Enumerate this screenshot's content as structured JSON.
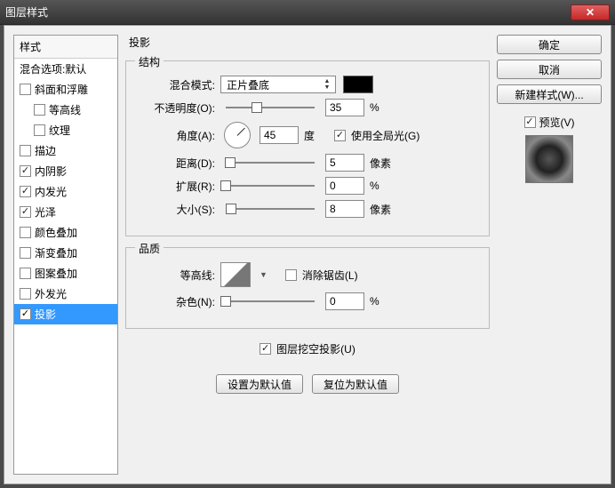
{
  "window": {
    "title": "图层样式"
  },
  "styles": {
    "header": "样式",
    "blend_defaults": "混合选项:默认",
    "items": [
      {
        "label": "斜面和浮雕",
        "checked": false,
        "indent": false
      },
      {
        "label": "等高线",
        "checked": false,
        "indent": true
      },
      {
        "label": "纹理",
        "checked": false,
        "indent": true
      },
      {
        "label": "描边",
        "checked": false,
        "indent": false
      },
      {
        "label": "内阴影",
        "checked": true,
        "indent": false
      },
      {
        "label": "内发光",
        "checked": true,
        "indent": false
      },
      {
        "label": "光泽",
        "checked": true,
        "indent": false
      },
      {
        "label": "颜色叠加",
        "checked": false,
        "indent": false
      },
      {
        "label": "渐变叠加",
        "checked": false,
        "indent": false
      },
      {
        "label": "图案叠加",
        "checked": false,
        "indent": false
      },
      {
        "label": "外发光",
        "checked": false,
        "indent": false
      },
      {
        "label": "投影",
        "checked": true,
        "indent": false,
        "selected": true
      }
    ]
  },
  "center": {
    "title": "投影",
    "structure": {
      "title": "结构",
      "blend_mode_label": "混合模式:",
      "blend_mode_value": "正片叠底",
      "color": "#000000",
      "opacity_label": "不透明度(O):",
      "opacity_value": "35",
      "opacity_unit": "%",
      "opacity_pos": "35%",
      "angle_label": "角度(A):",
      "angle_value": "45",
      "angle_unit": "度",
      "global_light_label": "使用全局光(G)",
      "global_light_checked": true,
      "distance_label": "距离(D):",
      "distance_value": "5",
      "distance_unit": "像素",
      "distance_pos": "5%",
      "spread_label": "扩展(R):",
      "spread_value": "0",
      "spread_unit": "%",
      "spread_pos": "0%",
      "size_label": "大小(S):",
      "size_value": "8",
      "size_unit": "像素",
      "size_pos": "6%"
    },
    "quality": {
      "title": "品质",
      "contour_label": "等高线:",
      "antialias_label": "消除锯齿(L)",
      "antialias_checked": false,
      "noise_label": "杂色(N):",
      "noise_value": "0",
      "noise_unit": "%",
      "noise_pos": "0%"
    },
    "knockout_label": "图层挖空投影(U)",
    "knockout_checked": true,
    "btn_set_default": "设置为默认值",
    "btn_reset_default": "复位为默认值"
  },
  "right": {
    "ok": "确定",
    "cancel": "取消",
    "new_style": "新建样式(W)...",
    "preview_label": "预览(V)",
    "preview_checked": true
  }
}
